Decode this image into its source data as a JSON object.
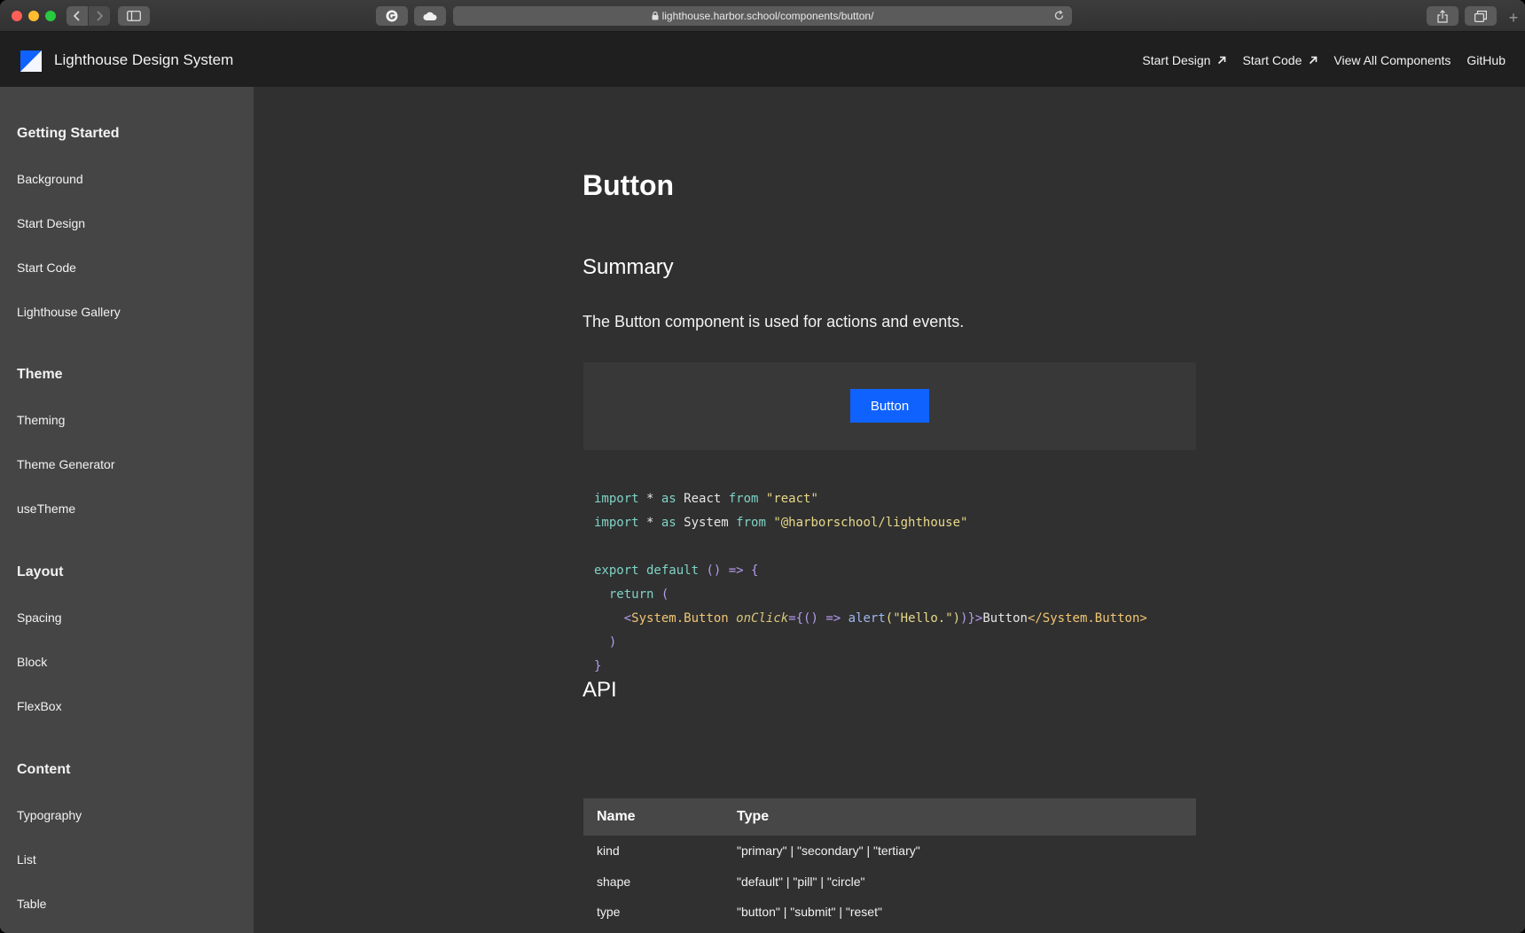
{
  "browser": {
    "url": "lighthouse.harbor.school/components/button/"
  },
  "header": {
    "title": "Lighthouse Design System",
    "nav": [
      {
        "label": "Start Design",
        "external": true
      },
      {
        "label": "Start Code",
        "external": true
      },
      {
        "label": "View All Components",
        "external": false
      },
      {
        "label": "GitHub",
        "external": false
      }
    ]
  },
  "sidebar": {
    "sections": [
      {
        "heading": "Getting Started",
        "items": [
          "Background",
          "Start Design",
          "Start Code",
          "Lighthouse Gallery"
        ]
      },
      {
        "heading": "Theme",
        "items": [
          "Theming",
          "Theme Generator",
          "useTheme"
        ]
      },
      {
        "heading": "Layout",
        "items": [
          "Spacing",
          "Block",
          "FlexBox"
        ]
      },
      {
        "heading": "Content",
        "items": [
          "Typography",
          "List",
          "Table"
        ]
      }
    ]
  },
  "main": {
    "title": "Button",
    "summary_heading": "Summary",
    "summary_text": "The Button component is used for actions and events.",
    "demo_button_label": "Button",
    "code": {
      "line1": {
        "kw1": "import",
        "mid": " * ",
        "kw2": "as",
        "name": " React ",
        "kw3": "from",
        "str": " \"react\""
      },
      "line2": {
        "kw1": "import",
        "mid": " * ",
        "kw2": "as",
        "name": " System ",
        "kw3": "from",
        "str": " \"@harborschool/lighthouse\""
      },
      "line3": {
        "kw1": "export",
        "kw2": " default",
        "rest": " () => {"
      },
      "line4": {
        "kw": "return",
        "rest": " ("
      },
      "line5": {
        "open": "<",
        "tag": "System.Button",
        "attr": "onClick",
        "eq": "={() => ",
        "fn": "alert",
        "str": "(\"Hello.\")",
        "close": ")}>",
        "text": "Button",
        "endtag": "</System.Button>"
      },
      "line6": ")",
      "line7": "}"
    },
    "api_heading": "API",
    "api_table": {
      "headers": [
        "Name",
        "Type"
      ],
      "rows": [
        {
          "name": "kind",
          "type": "\"primary\" | \"secondary\" | \"tertiary\""
        },
        {
          "name": "shape",
          "type": "\"default\" | \"pill\" | \"circle\""
        },
        {
          "name": "type",
          "type": "\"button\" | \"submit\" | \"reset\""
        }
      ]
    }
  },
  "colors": {
    "accent": "#0f62fe",
    "sidebar_bg": "#454545",
    "content_bg": "#303030",
    "header_bg": "#1f1f1f"
  },
  "icons": [
    "lock-icon",
    "reload-icon",
    "back-icon",
    "forward-icon",
    "sidebar-icon",
    "share-icon",
    "tabs-icon",
    "external-arrow-icon",
    "theme-toggle-icon",
    "logo-icon"
  ]
}
